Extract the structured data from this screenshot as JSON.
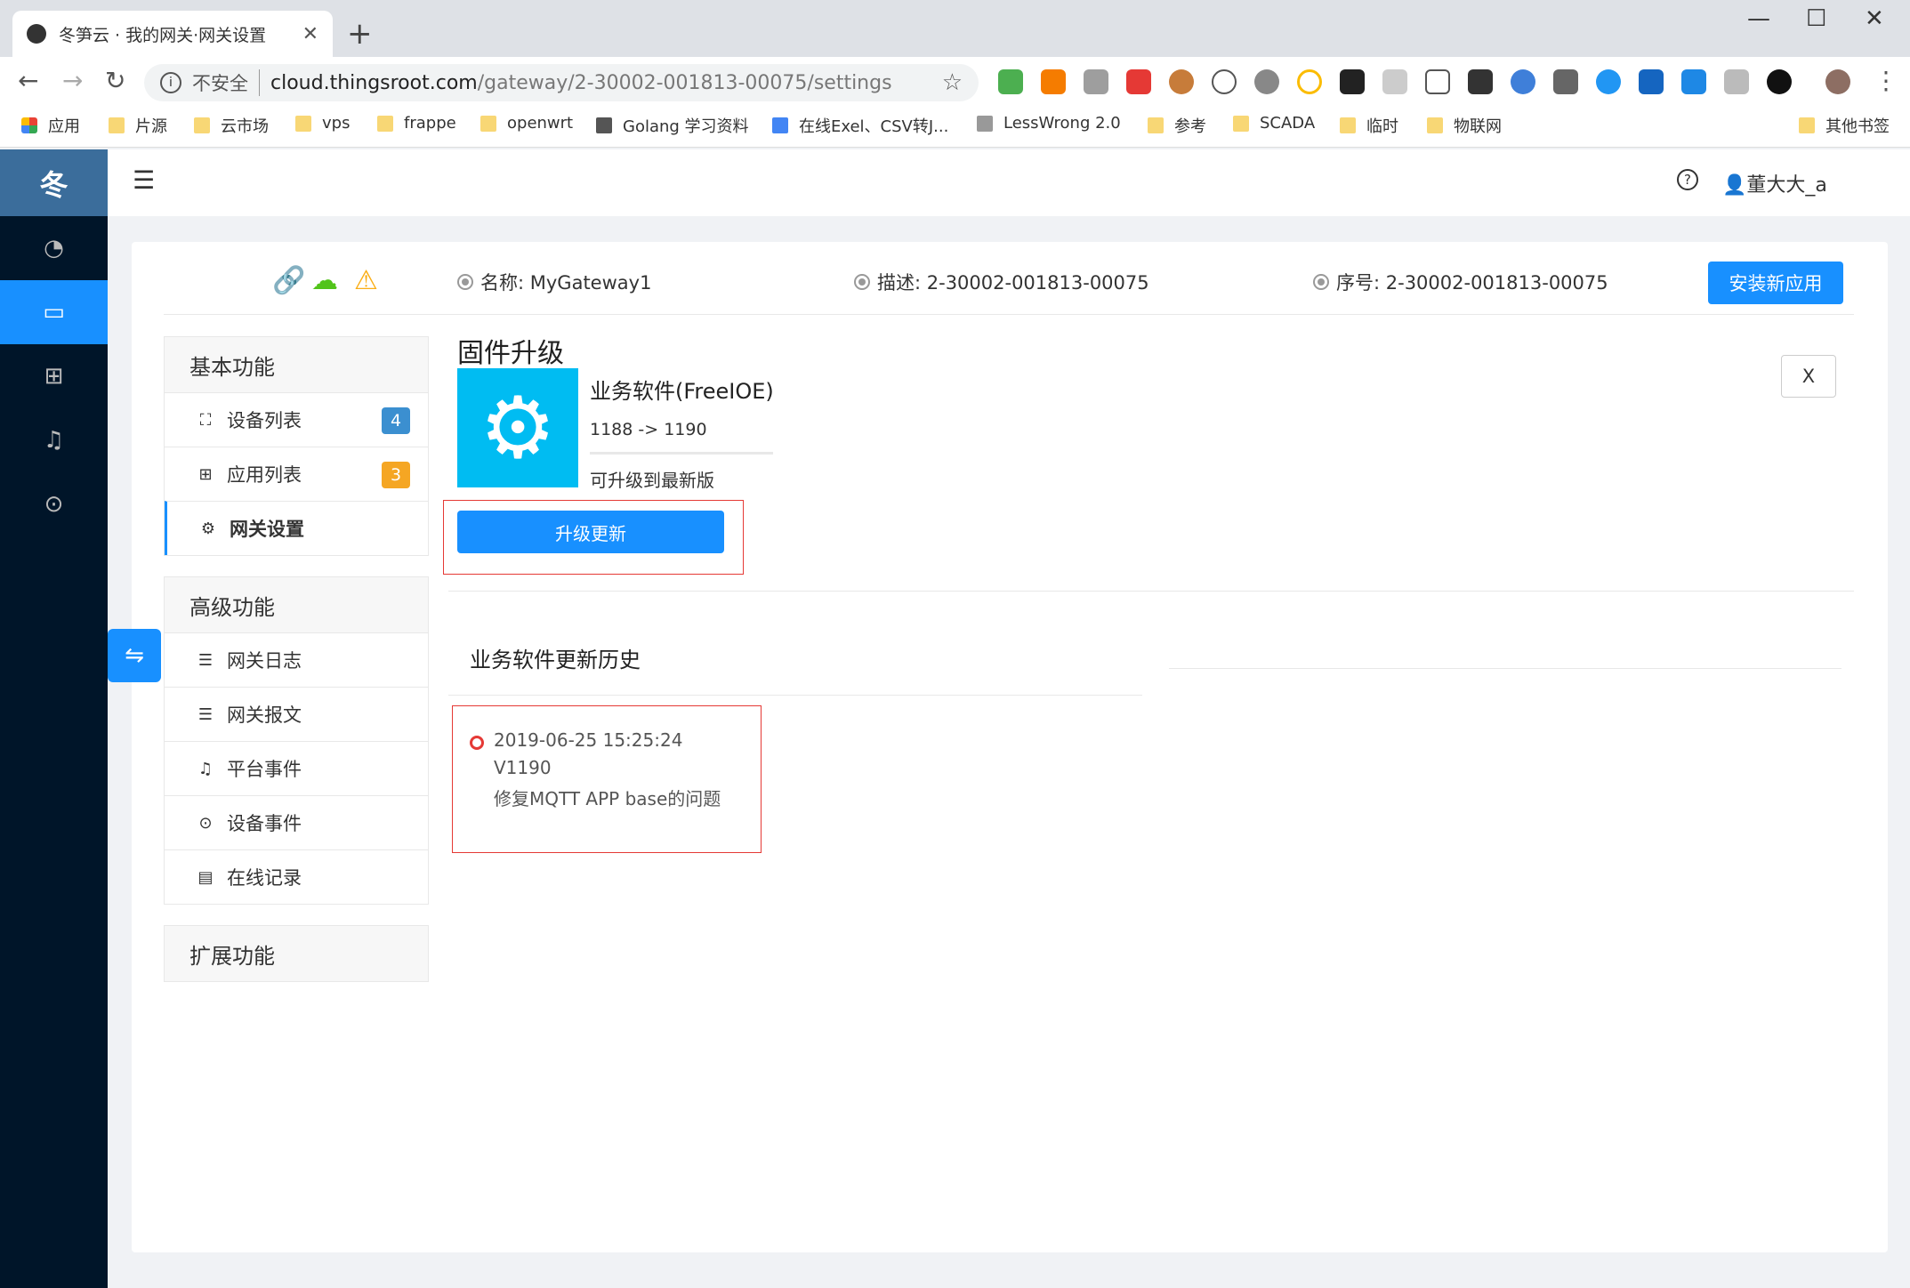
{
  "browser": {
    "tab_title": "冬笋云 · 我的网关·网关设置",
    "insecure_label": "不安全",
    "url_host": "cloud.thingsroot.com",
    "url_path": "/gateway/2-30002-001813-00075/settings",
    "bookmarks": [
      "应用",
      "片源",
      "云市场",
      "vps",
      "frappe",
      "openwrt",
      "Golang 学习资料",
      "在线Exel、CSV转J...",
      "LessWrong 2.0",
      "参考",
      "SCADA",
      "临时",
      "物联网",
      "其他书签"
    ]
  },
  "app": {
    "logo": "冬",
    "user": "董大大_a"
  },
  "gateway": {
    "name": "名称: MyGateway1",
    "desc": "描述: 2-30002-001813-00075",
    "serial": "序号: 2-30002-001813-00075",
    "install_label": "安装新应用"
  },
  "menu": {
    "basic_title": "基本功能",
    "basic_items": [
      "设备列表",
      "应用列表",
      "网关设置"
    ],
    "device_count": "4",
    "app_count": "3",
    "advanced_title": "高级功能",
    "advanced_items": [
      "网关日志",
      "网关报文",
      "平台事件",
      "设备事件",
      "在线记录"
    ],
    "extension_title": "扩展功能"
  },
  "firmware": {
    "title": "固件升级",
    "close_label": "X",
    "name": "业务软件(FreeIOE)",
    "version": "1188 -> 1190",
    "status": "可升级到最新版",
    "upgrade_label": "升级更新"
  },
  "history": {
    "title": "业务软件更新历史",
    "entries": [
      {
        "date": "2019-06-25 15:25:24",
        "version": "V1190",
        "desc": "修复MQTT APP base的问题"
      }
    ]
  },
  "colors": {
    "primary": "#1890ff",
    "sider": "#001529",
    "badge_blue": "#3b8fd0",
    "badge_orange": "#f5a623",
    "highlight": "#e53935"
  }
}
